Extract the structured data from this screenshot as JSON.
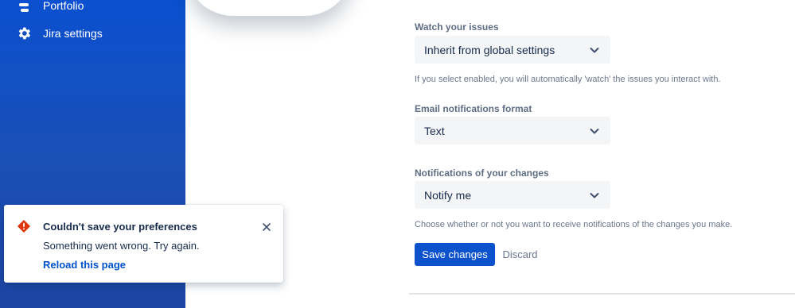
{
  "sidebar": {
    "items": [
      {
        "label": "Portfolio",
        "icon": "portfolio-icon"
      },
      {
        "label": "Jira settings",
        "icon": "gear-icon"
      }
    ]
  },
  "form": {
    "watch": {
      "label": "Watch your issues",
      "value": "Inherit from global settings",
      "help": "If you select enabled, you will automatically 'watch' the issues you interact with."
    },
    "email_format": {
      "label": "Email notifications format",
      "value": "Text"
    },
    "own_changes": {
      "label": "Notifications of your changes",
      "value": "Notify me",
      "help": "Choose whether or not you want to receive notifications of the changes you make."
    },
    "save_label": "Save changes",
    "discard_label": "Discard"
  },
  "toast": {
    "title": "Couldn't save your preferences",
    "description": "Something went wrong. Try again.",
    "action": "Reload this page",
    "icon": "error-icon"
  },
  "colors": {
    "sidebar": "#1b4fb4",
    "primary": "#0b52cc",
    "error": "#de350b",
    "link": "#0052cc"
  }
}
